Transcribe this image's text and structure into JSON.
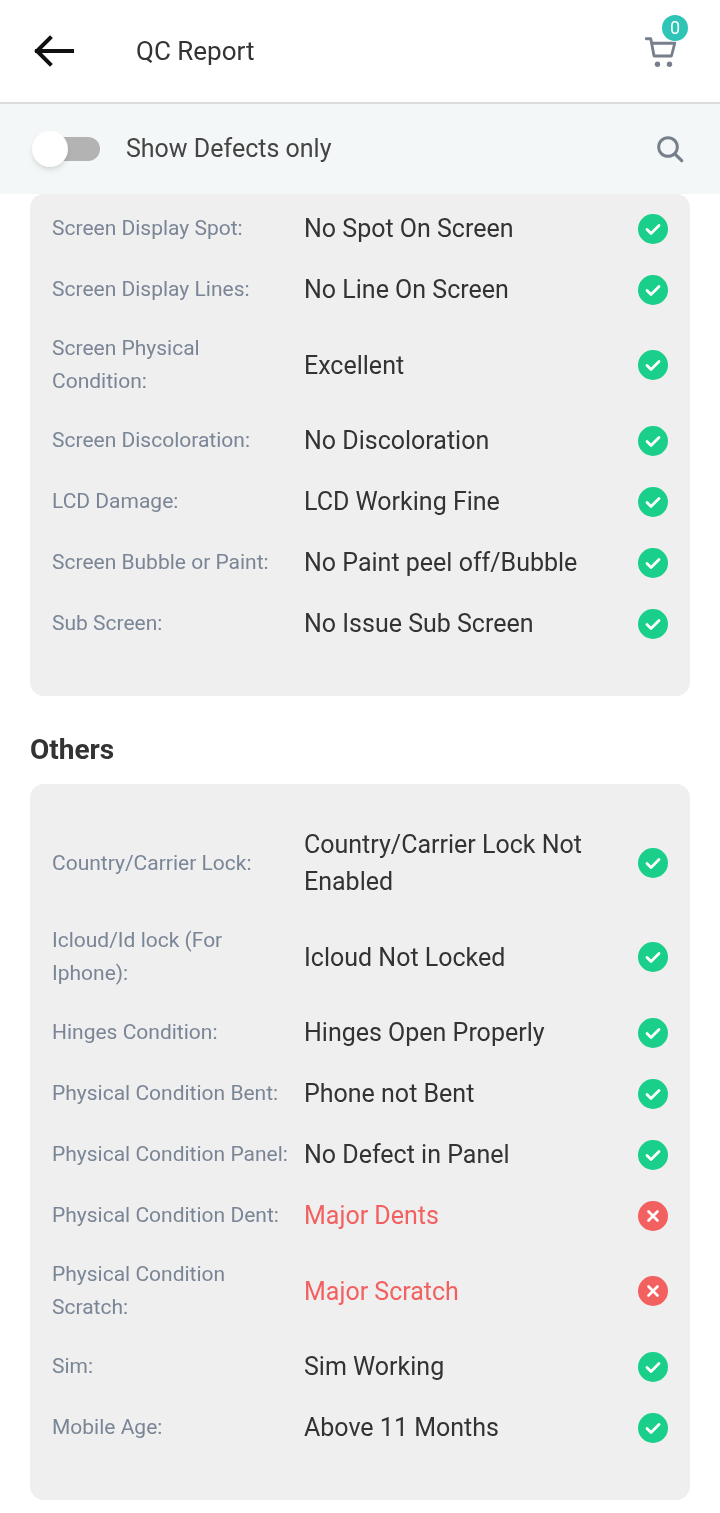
{
  "header": {
    "title": "QC Report",
    "cart_count": "0"
  },
  "filter": {
    "label": "Show Defects only",
    "on": false
  },
  "sections": [
    {
      "rows": [
        {
          "label": "Screen Display Spot:",
          "value": "No Spot On Screen",
          "defect": false
        },
        {
          "label": "Screen Display Lines:",
          "value": "No Line On Screen",
          "defect": false
        },
        {
          "label": "Screen Physical Condition:",
          "value": "Excellent",
          "defect": false
        },
        {
          "label": "Screen Discoloration:",
          "value": "No Discoloration",
          "defect": false
        },
        {
          "label": "LCD Damage:",
          "value": "LCD Working Fine",
          "defect": false
        },
        {
          "label": "Screen Bubble or Paint:",
          "value": "No Paint peel off/Bubble",
          "defect": false
        },
        {
          "label": "Sub Screen:",
          "value": "No Issue Sub Screen",
          "defect": false
        }
      ]
    },
    {
      "title": "Others",
      "rows": [
        {
          "label": "Country/Carrier Lock:",
          "value": "Country/Carrier Lock Not Enabled",
          "defect": false
        },
        {
          "label": "Icloud/Id lock (For Iphone):",
          "value": "Icloud Not Locked",
          "defect": false
        },
        {
          "label": "Hinges Condition:",
          "value": "Hinges Open Properly",
          "defect": false
        },
        {
          "label": "Physical Condition Bent:",
          "value": "Phone not Bent",
          "defect": false
        },
        {
          "label": "Physical Condition Panel:",
          "value": "No Defect in Panel",
          "defect": false
        },
        {
          "label": "Physical Condition Dent:",
          "value": "Major Dents",
          "defect": true
        },
        {
          "label": "Physical Condition Scratch:",
          "value": "Major Scratch",
          "defect": true
        },
        {
          "label": "Sim:",
          "value": "Sim Working",
          "defect": false
        },
        {
          "label": "Mobile Age:",
          "value": "Above 11 Months",
          "defect": false
        }
      ]
    }
  ]
}
